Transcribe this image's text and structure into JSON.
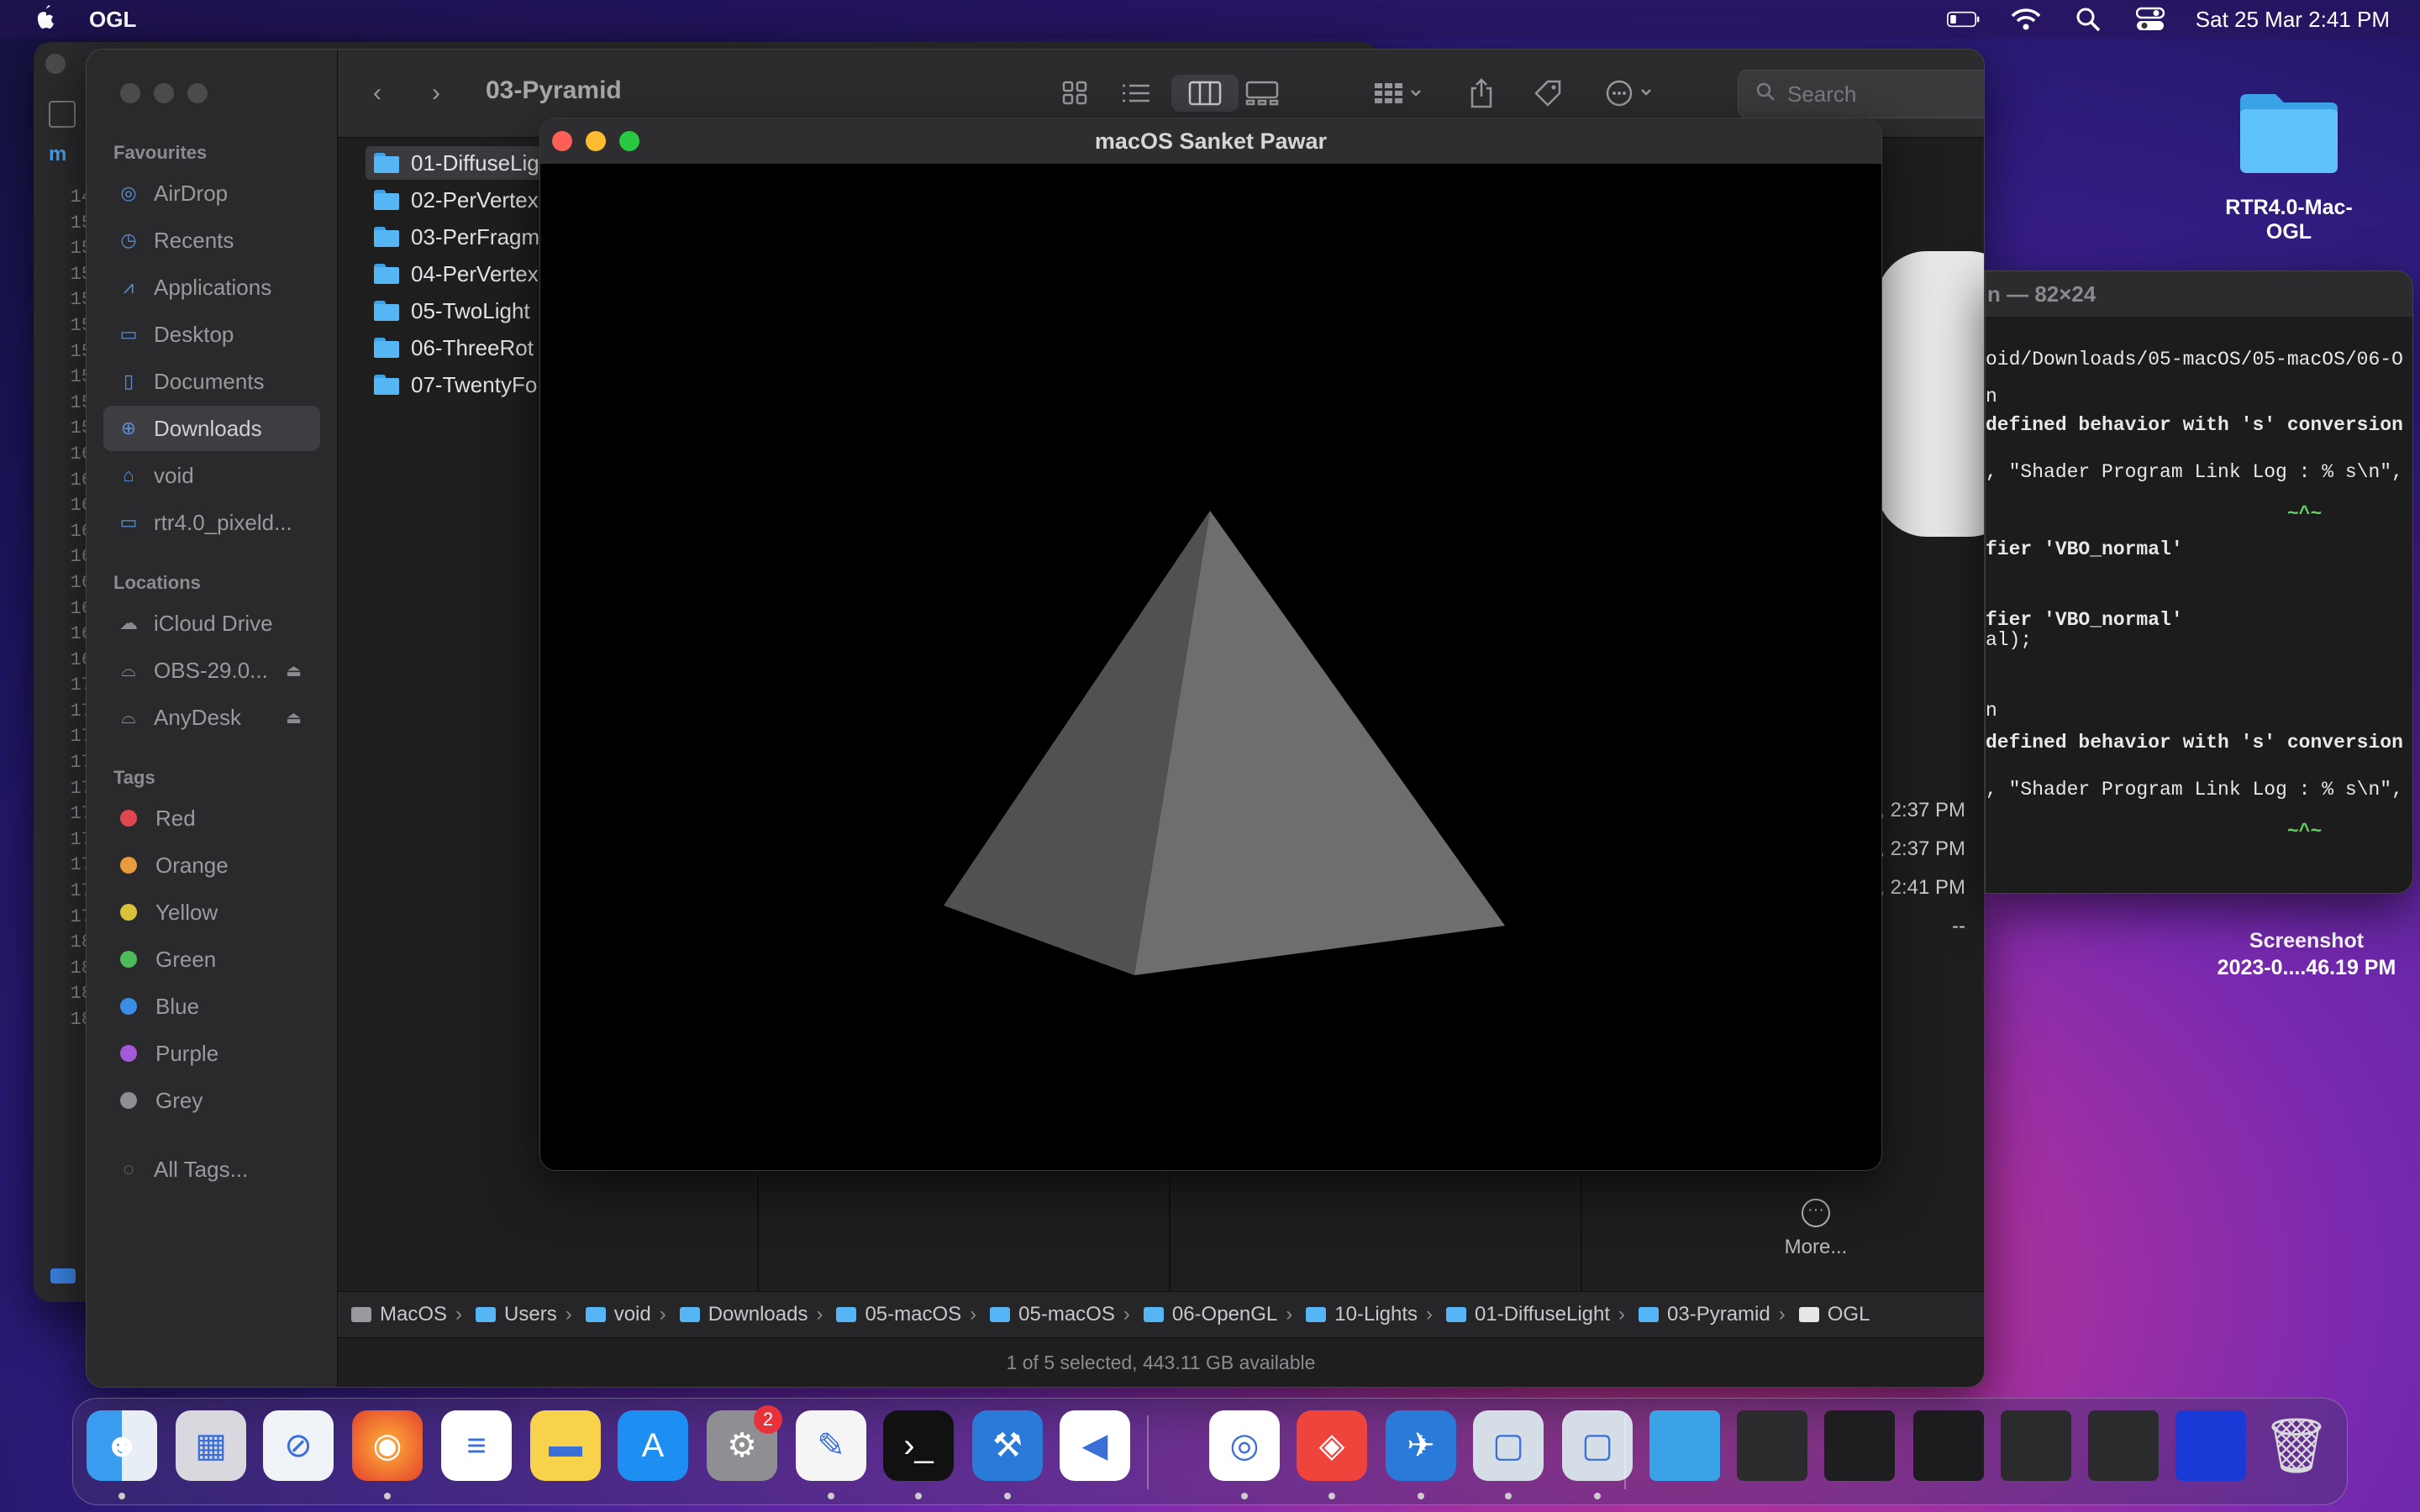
{
  "menubar": {
    "app_name": "OGL",
    "datetime": "Sat 25 Mar  2:41 PM"
  },
  "finder": {
    "title": "03-Pyramid",
    "search_placeholder": "Search",
    "sidebar": {
      "favourites_header": "Favourites",
      "favourites": [
        "AirDrop",
        "Recents",
        "Applications",
        "Desktop",
        "Documents",
        "Downloads",
        "void",
        "rtr4.0_pixeld..."
      ],
      "locations_header": "Locations",
      "locations": [
        "iCloud Drive",
        "OBS-29.0...",
        "AnyDesk"
      ],
      "tags_header": "Tags",
      "tags": [
        {
          "label": "Red",
          "color": "#e0474c"
        },
        {
          "label": "Orange",
          "color": "#e89a3c"
        },
        {
          "label": "Yellow",
          "color": "#d9c13a"
        },
        {
          "label": "Green",
          "color": "#4cbb58"
        },
        {
          "label": "Blue",
          "color": "#3a8ee6"
        },
        {
          "label": "Purple",
          "color": "#a45ad6"
        },
        {
          "label": "Grey",
          "color": "#8e8e93"
        }
      ],
      "all_tags": "All Tags..."
    },
    "files": [
      "01-DiffuseLig",
      "02-PerVertex",
      "03-PerFragm",
      "04-PerVertex",
      "05-TwoLight",
      "06-ThreeRot",
      "07-TwentyFo"
    ],
    "preview_dates": [
      ", 2:37 PM",
      ", 2:37 PM",
      ", 2:41 PM",
      "--"
    ],
    "more_label": "More...",
    "path": [
      "MacOS",
      "Users",
      "void",
      "Downloads",
      "05-macOS",
      "05-macOS",
      "06-OpenGL",
      "10-Lights",
      "01-DiffuseLight",
      "03-Pyramid",
      "OGL"
    ],
    "status": "1 of 5 selected, 443.11 GB available"
  },
  "ogl_window": {
    "title": "macOS Sanket Pawar"
  },
  "terminal": {
    "title": "n — 82×24",
    "lines": [
      {
        "text": "oid/Downloads/05-macOS/05-macOS/06-O",
        "style": "n"
      },
      {
        "text": "n                                    ]",
        "style": "n"
      },
      {
        "text": "defined behavior with 's' conversion",
        "style": ""
      },
      {
        "text": ", \"Shader Program Link Log : % s\\n\",",
        "style": "n"
      },
      {
        "text": "                          ~^~",
        "style": "g"
      },
      {
        "text": "fier 'VBO_normal'",
        "style": ""
      },
      {
        "text": "fier 'VBO_normal'",
        "style": ""
      },
      {
        "text": "al);",
        "style": "n"
      },
      {
        "text": "n                                    ]",
        "style": "n"
      },
      {
        "text": "defined behavior with 's' conversion",
        "style": ""
      },
      {
        "text": ", \"Shader Program Link Log : % s\\n\",",
        "style": "n"
      },
      {
        "text": "                          ~^~",
        "style": "g"
      }
    ]
  },
  "back_window": {
    "line_numbers": [
      "14",
      "15",
      "15",
      "15",
      "15",
      "15",
      "15",
      "15",
      "15",
      "15",
      "16",
      "16",
      "16",
      "16",
      "16",
      "16",
      "16",
      "16",
      "16",
      "17",
      "17",
      "17",
      "17",
      "17",
      "17",
      "17",
      "17",
      "17",
      "17",
      "18",
      "18",
      "18",
      "18"
    ]
  },
  "desktop": {
    "folder_label": "RTR4.0-Mac-OGL",
    "screenshot_line1": "Screenshot",
    "screenshot_line2": "2023-0....46.19 PM"
  },
  "dock": {
    "settings_badge": "2",
    "apps": [
      "finder",
      "launchpad",
      "safari",
      "firefox",
      "reminders",
      "notes",
      "app-store",
      "system-settings",
      "textedit",
      "terminal",
      "xcode",
      "vscode",
      "chrome",
      "anydesk",
      "simulator",
      "preview-1",
      "preview-2"
    ]
  }
}
